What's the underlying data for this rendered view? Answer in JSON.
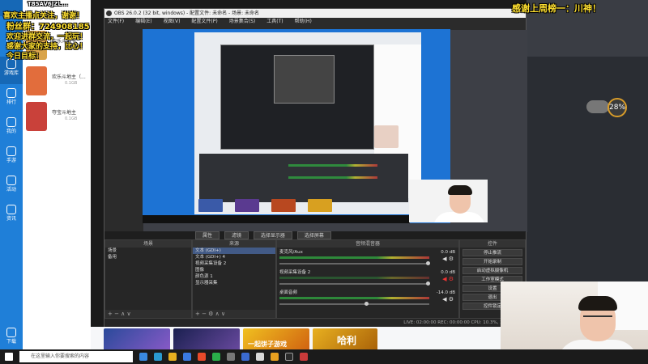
{
  "overlay": {
    "thanks": "感谢上周榜一：川神！",
    "line1": "喜欢主播点关注，谢谢！",
    "fan_group_label": "粉丝群：",
    "fan_group_number": "724908185",
    "line3": "欢迎进群交流，一起玩！",
    "line4": "感谢大家的支持，比心！",
    "line5": "今日目标："
  },
  "user": {
    "id": "T85AV6JZL..."
  },
  "sidebar": {
    "items": [
      {
        "label": "首页"
      },
      {
        "label": "游戏库"
      },
      {
        "label": "排行"
      },
      {
        "label": "我的"
      },
      {
        "label": "手游"
      },
      {
        "label": "活动"
      },
      {
        "label": "资讯"
      },
      {
        "label": "下载"
      }
    ]
  },
  "games": [
    {
      "name": "欢乐斗地主",
      "size": "0.1GB"
    },
    {
      "name": "欢乐斗地主（...",
      "size": "0.1GB"
    },
    {
      "name": "夺宝斗地主",
      "size": "0.1GB"
    }
  ],
  "obs": {
    "title": "OBS 26.0.2 (32 bit, windows) - 配置文件: 未命名 - 场景: 未命名",
    "menu": [
      "文件(F)",
      "编辑(E)",
      "视图(V)",
      "配置文件(P)",
      "场景集合(S)",
      "工具(T)",
      "帮助(H)"
    ],
    "scene_bar": {
      "settings_label": "属性",
      "filters_label": "滤镜",
      "source_select": "选择显示器",
      "select_label": "选择屏幕"
    },
    "docks": {
      "scenes": {
        "title": "场景",
        "items": [
          "场景",
          "备用"
        ]
      },
      "sources": {
        "title": "来源",
        "items": [
          "文本 (GDI+)",
          "文本 (GDI+) 4",
          "视频采集设备 2",
          "图像",
          "颜色源 1",
          "显示器采集"
        ]
      },
      "mixer": {
        "title": "音频混音器",
        "channels": [
          {
            "name": "麦克风/Aux",
            "db": "0.0 dB"
          },
          {
            "name": "视频采集设备 2",
            "db": "0.0 dB"
          },
          {
            "name": "桌面音频",
            "db": "-14.0 dB"
          }
        ]
      },
      "controls": {
        "title": "控件",
        "buttons": [
          "停止推流",
          "开始录制",
          "启动虚拟摄像机",
          "工作室模式",
          "设置",
          "退出",
          "控件锁定"
        ],
        "delay_label": "过渡",
        "delay_value": "2 ms"
      }
    },
    "status": "LIVE: 02:00:00   REC: 00:00:00   CPU: 10.3%, 30.00 fps"
  },
  "right_panel": {
    "badge": "28%"
  },
  "taskbar": {
    "search_placeholder": "在这里输入你要搜索的内容"
  },
  "promo": {
    "banner_text": "一起饼子游戏",
    "brand_text": "哈利"
  }
}
